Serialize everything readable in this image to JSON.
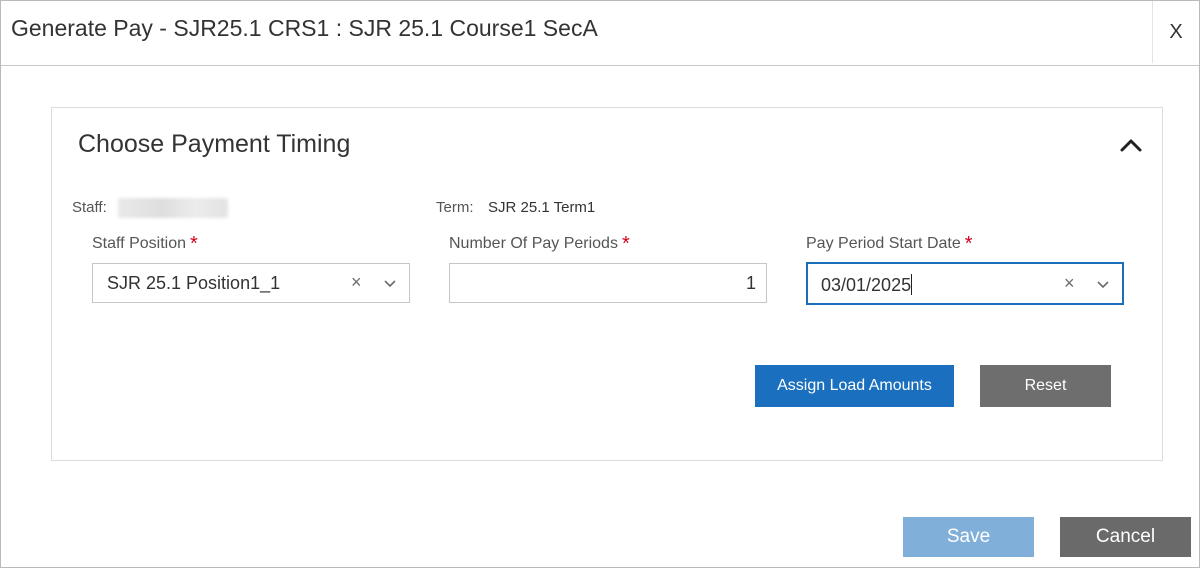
{
  "dialog": {
    "title": "Generate Pay - SJR25.1 CRS1 : SJR 25.1 Course1 SecA",
    "close_label": "X"
  },
  "panel": {
    "title": "Choose Payment Timing",
    "staff_label": "Staff:",
    "term_label": "Term:",
    "term_value": "SJR 25.1 Term1"
  },
  "fields": {
    "staff_position": {
      "label": "Staff Position",
      "required": "*",
      "value": "SJR 25.1 Position1_1"
    },
    "num_pay_periods": {
      "label": "Number Of Pay Periods",
      "required": "*",
      "value": "1"
    },
    "pay_period_start": {
      "label": "Pay Period Start Date",
      "required": "*",
      "value": "03/01/2025"
    }
  },
  "buttons": {
    "assign_load": "Assign Load Amounts",
    "reset": "Reset",
    "save": "Save",
    "cancel": "Cancel"
  },
  "icons": {
    "clear": "×",
    "chevron": "chevron-down-icon",
    "collapse": "chevron-up-icon"
  },
  "colors": {
    "primary": "#1a6fbe",
    "save_disabled": "#80afd9",
    "grey_button": "#6e6e6e",
    "required": "#d0021b",
    "focus_border": "#1a6fb8"
  }
}
